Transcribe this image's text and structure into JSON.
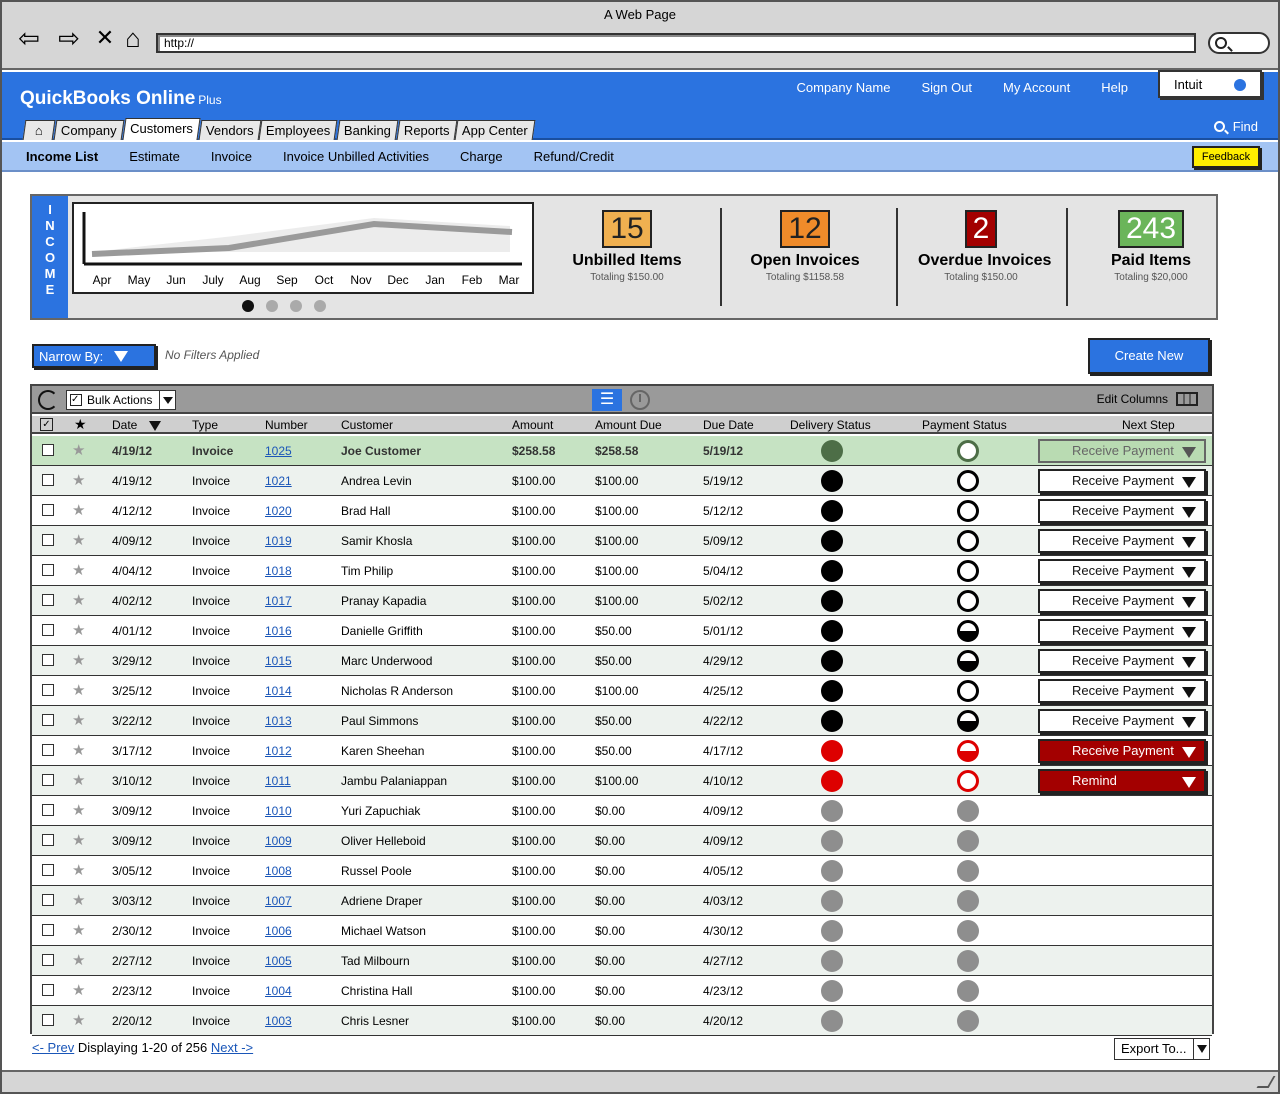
{
  "window": {
    "title": "A Web Page",
    "url": "http://"
  },
  "app": {
    "brand": "QuickBooks Online",
    "brand_plus": "Plus",
    "top_links": [
      "Company Name",
      "Sign Out",
      "My Account",
      "Help"
    ],
    "intuit_label": "Intuit",
    "find_label": "Find",
    "tabs": [
      "Company",
      "Customers",
      "Vendors",
      "Employees",
      "Banking",
      "Reports",
      "App Center"
    ],
    "active_tab": "Customers",
    "subnav": [
      "Income List",
      "Estimate",
      "Invoice",
      "Invoice Unbilled Activities",
      "Charge",
      "Refund/Credit"
    ],
    "feedback_label": "Feedback"
  },
  "income": {
    "side_label": "INCOME",
    "months": [
      "Apr",
      "May",
      "Jun",
      "July",
      "Aug",
      "Sep",
      "Oct",
      "Nov",
      "Dec",
      "Jan",
      "Feb",
      "Mar"
    ],
    "stats": [
      {
        "value": "15",
        "label": "Unbilled Items",
        "sub": "Totaling $150.00",
        "color": "#f0b050"
      },
      {
        "value": "12",
        "label": "Open Invoices",
        "sub": "Totaling $1158.58",
        "color": "#ef8b2a"
      },
      {
        "value": "2",
        "label": "Overdue Invoices",
        "sub": "Totaling $150.00",
        "color": "#a30000"
      },
      {
        "value": "243",
        "label": "Paid Items",
        "sub": "Totaling $20,000",
        "color": "#6bb55a"
      }
    ]
  },
  "filters": {
    "narrow_label": "Narrow By:",
    "status": "No Filters Applied",
    "create_label": "Create New"
  },
  "grid": {
    "bulk_label": "Bulk Actions",
    "edit_columns_label": "Edit Columns",
    "columns": [
      "Date",
      "Type",
      "Number",
      "Customer",
      "Amount",
      "Amount Due",
      "Due Date",
      "Delivery Status",
      "Payment Status",
      "Next Step"
    ],
    "rows": [
      {
        "date": "4/19/12",
        "type": "Invoice",
        "number": "1025",
        "customer": "Joe Customer",
        "amount": "$258.58",
        "due": "$258.58",
        "due_date": "5/19/12",
        "delivery": "green",
        "payment": "ring-green",
        "next": "Receive Payment",
        "style": "green"
      },
      {
        "date": "4/19/12",
        "type": "Invoice",
        "number": "1021",
        "customer": "Andrea Levin",
        "amount": "$100.00",
        "due": "$100.00",
        "due_date": "5/19/12",
        "delivery": "black",
        "payment": "ring",
        "next": "Receive Payment",
        "style": "normal"
      },
      {
        "date": "4/12/12",
        "type": "Invoice",
        "number": "1020",
        "customer": "Brad Hall",
        "amount": "$100.00",
        "due": "$100.00",
        "due_date": "5/12/12",
        "delivery": "black",
        "payment": "ring",
        "next": "Receive Payment",
        "style": "normal"
      },
      {
        "date": "4/09/12",
        "type": "Invoice",
        "number": "1019",
        "customer": "Samir Khosla",
        "amount": "$100.00",
        "due": "$100.00",
        "due_date": "5/09/12",
        "delivery": "black",
        "payment": "ring",
        "next": "Receive Payment",
        "style": "normal"
      },
      {
        "date": "4/04/12",
        "type": "Invoice",
        "number": "1018",
        "customer": "Tim Philip",
        "amount": "$100.00",
        "due": "$100.00",
        "due_date": "5/04/12",
        "delivery": "black",
        "payment": "ring",
        "next": "Receive Payment",
        "style": "normal"
      },
      {
        "date": "4/02/12",
        "type": "Invoice",
        "number": "1017",
        "customer": "Pranay Kapadia",
        "amount": "$100.00",
        "due": "$100.00",
        "due_date": "5/02/12",
        "delivery": "black",
        "payment": "ring",
        "next": "Receive Payment",
        "style": "normal"
      },
      {
        "date": "4/01/12",
        "type": "Invoice",
        "number": "1016",
        "customer": "Danielle Griffith",
        "amount": "$100.00",
        "due": "$50.00",
        "due_date": "5/01/12",
        "delivery": "black",
        "payment": "half",
        "next": "Receive Payment",
        "style": "normal"
      },
      {
        "date": "3/29/12",
        "type": "Invoice",
        "number": "1015",
        "customer": "Marc Underwood",
        "amount": "$100.00",
        "due": "$50.00",
        "due_date": "4/29/12",
        "delivery": "black",
        "payment": "half",
        "next": "Receive Payment",
        "style": "normal"
      },
      {
        "date": "3/25/12",
        "type": "Invoice",
        "number": "1014",
        "customer": "Nicholas R Anderson",
        "amount": "$100.00",
        "due": "$100.00",
        "due_date": "4/25/12",
        "delivery": "black",
        "payment": "ring",
        "next": "Receive Payment",
        "style": "normal"
      },
      {
        "date": "3/22/12",
        "type": "Invoice",
        "number": "1013",
        "customer": "Paul Simmons",
        "amount": "$100.00",
        "due": "$50.00",
        "due_date": "4/22/12",
        "delivery": "black",
        "payment": "half",
        "next": "Receive Payment",
        "style": "normal"
      },
      {
        "date": "3/17/12",
        "type": "Invoice",
        "number": "1012",
        "customer": "Karen Sheehan",
        "amount": "$100.00",
        "due": "$50.00",
        "due_date": "4/17/12",
        "delivery": "red",
        "payment": "half-red",
        "next": "Receive Payment",
        "style": "red"
      },
      {
        "date": "3/10/12",
        "type": "Invoice",
        "number": "1011",
        "customer": "Jambu Palaniappan",
        "amount": "$100.00",
        "due": "$100.00",
        "due_date": "4/10/12",
        "delivery": "red",
        "payment": "ring-red",
        "next": "Remind",
        "style": "red"
      },
      {
        "date": "3/09/12",
        "type": "Invoice",
        "number": "1010",
        "customer": "Yuri Zapuchiak",
        "amount": "$100.00",
        "due": "$0.00",
        "due_date": "4/09/12",
        "delivery": "gray",
        "payment": "gray",
        "next": "",
        "style": "none"
      },
      {
        "date": "3/09/12",
        "type": "Invoice",
        "number": "1009",
        "customer": "Oliver Helleboid",
        "amount": "$100.00",
        "due": "$0.00",
        "due_date": "4/09/12",
        "delivery": "gray",
        "payment": "gray",
        "next": "",
        "style": "none"
      },
      {
        "date": "3/05/12",
        "type": "Invoice",
        "number": "1008",
        "customer": "Russel Poole",
        "amount": "$100.00",
        "due": "$0.00",
        "due_date": "4/05/12",
        "delivery": "gray",
        "payment": "gray",
        "next": "",
        "style": "none"
      },
      {
        "date": "3/03/12",
        "type": "Invoice",
        "number": "1007",
        "customer": "Adriene Draper",
        "amount": "$100.00",
        "due": "$0.00",
        "due_date": "4/03/12",
        "delivery": "gray",
        "payment": "gray",
        "next": "",
        "style": "none"
      },
      {
        "date": "2/30/12",
        "type": "Invoice",
        "number": "1006",
        "customer": "Michael Watson",
        "amount": "$100.00",
        "due": "$0.00",
        "due_date": "4/30/12",
        "delivery": "gray",
        "payment": "gray",
        "next": "",
        "style": "none"
      },
      {
        "date": "2/27/12",
        "type": "Invoice",
        "number": "1005",
        "customer": "Tad Milbourn",
        "amount": "$100.00",
        "due": "$0.00",
        "due_date": "4/27/12",
        "delivery": "gray",
        "payment": "gray",
        "next": "",
        "style": "none"
      },
      {
        "date": "2/23/12",
        "type": "Invoice",
        "number": "1004",
        "customer": "Christina Hall",
        "amount": "$100.00",
        "due": "$0.00",
        "due_date": "4/23/12",
        "delivery": "gray",
        "payment": "gray",
        "next": "",
        "style": "none"
      },
      {
        "date": "2/20/12",
        "type": "Invoice",
        "number": "1003",
        "customer": "Chris Lesner",
        "amount": "$100.00",
        "due": "$0.00",
        "due_date": "4/20/12",
        "delivery": "gray",
        "payment": "gray",
        "next": "",
        "style": "none"
      }
    ]
  },
  "pager": {
    "prev": "<- Prev",
    "info": "Displaying 1-20 of 256",
    "next": "Next ->",
    "export_label": "Export To..."
  }
}
